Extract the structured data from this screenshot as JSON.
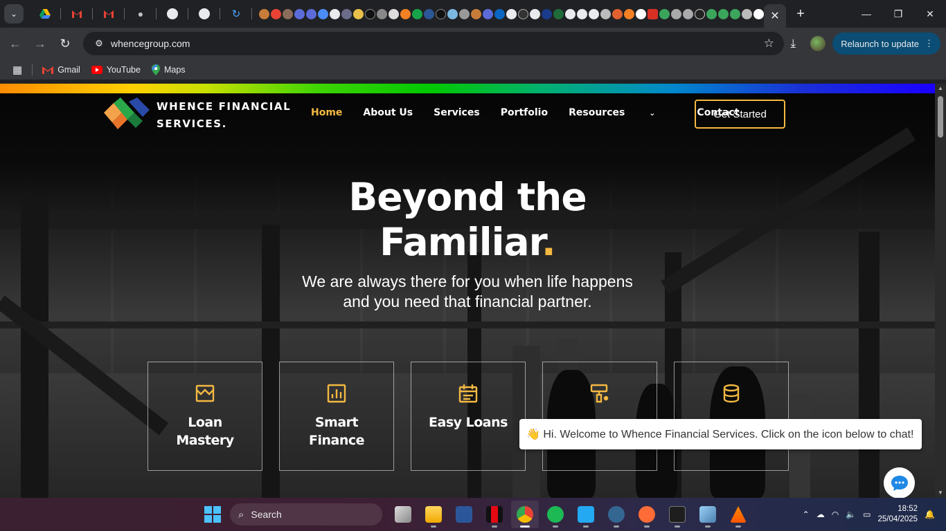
{
  "browser": {
    "url": "whencegroup.com",
    "relaunch_label": "Relaunch to update",
    "bookmarks": [
      {
        "label": "Gmail",
        "icon": "gmail-icon"
      },
      {
        "label": "YouTube",
        "icon": "youtube-icon"
      },
      {
        "label": "Maps",
        "icon": "maps-icon"
      }
    ],
    "active_tab_close": "✕",
    "new_tab": "+"
  },
  "site": {
    "brand_line1": "WHENCE FINANCIAL",
    "brand_line2": "SERVICES.",
    "nav": {
      "home": "Home",
      "about": "About Us",
      "services": "Services",
      "portfolio": "Portfolio",
      "resources": "Resources",
      "contact": "Contact"
    },
    "cta": "Get Started",
    "headline_line1": "Beyond the",
    "headline_line2": "Familiar",
    "headline_dot": ".",
    "subtitle_line1": "We are always there for you when life happens",
    "subtitle_line2": "and you need that financial partner.",
    "cards": [
      {
        "title": "Loan Mastery",
        "icon": "storefront-icon"
      },
      {
        "title": "Smart Finance",
        "icon": "bar-chart-icon"
      },
      {
        "title": "Easy Loans",
        "icon": "calendar-icon"
      },
      {
        "title": "",
        "icon": "paint-roller-icon"
      },
      {
        "title": "",
        "icon": "database-coins-icon"
      }
    ],
    "chat_message": "👋 Hi. Welcome to Whence Financial Services. Click on the icon below to chat!",
    "accent_color": "#f5b942"
  },
  "taskbar": {
    "search_label": "Search",
    "time": "18:52",
    "date": "25/04/2025"
  }
}
